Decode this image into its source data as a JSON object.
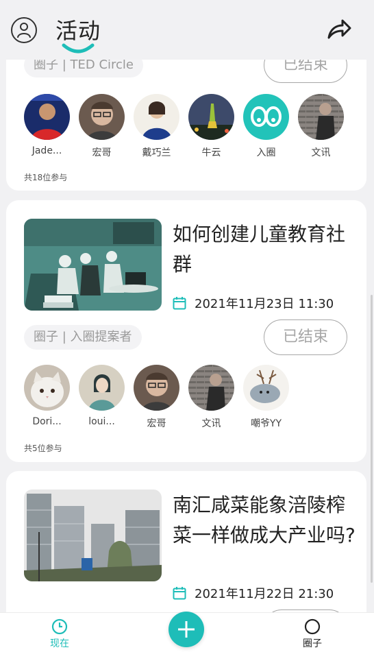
{
  "header": {
    "title": "活动",
    "profile_icon": "person-icon",
    "share_icon": "share-arrow-icon",
    "accent": "#1ebdb8"
  },
  "cards": [
    {
      "circle": "圈子 | TED Circle",
      "status": "已结束",
      "participants": [
        {
          "name": "Jade...",
          "avatar": "avatar-red-shirt"
        },
        {
          "name": "宏哥",
          "avatar": "avatar-glasses"
        },
        {
          "name": "戴巧兰",
          "avatar": "avatar-woman"
        },
        {
          "name": "牛云",
          "avatar": "avatar-tower"
        },
        {
          "name": "入圈",
          "avatar": "avatar-teal-logo"
        },
        {
          "name": "文讯",
          "avatar": "avatar-man-wall"
        }
      ],
      "count": "共18位参与"
    },
    {
      "title": "如何创建儿童教育社群",
      "date": "2021年11月23日 11:30",
      "circle": "圈子 | 入圈提案者",
      "status": "已结束",
      "participants": [
        {
          "name": "Dori...",
          "avatar": "avatar-cat"
        },
        {
          "name": "loui...",
          "avatar": "avatar-painting"
        },
        {
          "name": "宏哥",
          "avatar": "avatar-glasses"
        },
        {
          "name": "文讯",
          "avatar": "avatar-man-wall"
        },
        {
          "name": "嘲爷YY",
          "avatar": "avatar-deer"
        }
      ],
      "count": "共5位参与"
    },
    {
      "title": "南汇咸菜能象涪陵榨菜一样做成大产业吗?",
      "date": "2021年11月22日 21:30"
    }
  ],
  "nav": {
    "now_label": "现在",
    "circle_label": "圈子",
    "add_icon": "plus-icon",
    "active_color": "#1ebdb8"
  }
}
